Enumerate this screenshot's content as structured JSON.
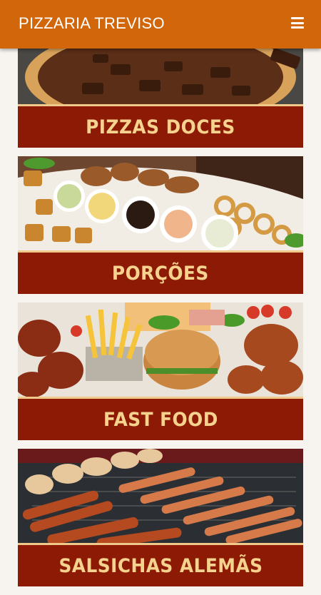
{
  "header": {
    "title": "PIZZARIA TREVISO",
    "menu_icon": "hamburger-menu-icon",
    "color": "#d2660b"
  },
  "categories": [
    {
      "label": "PIZZAS DOCES",
      "image": "chocolate-pizza-image"
    },
    {
      "label": "PORÇÕES",
      "image": "appetizer-platter-image"
    },
    {
      "label": "FAST FOOD",
      "image": "fast-food-image"
    },
    {
      "label": "SALSICHAS ALEMÃS",
      "image": "sausages-grill-image"
    }
  ],
  "colors": {
    "band_background": "#8c1a04",
    "band_text": "#f5d28e"
  }
}
